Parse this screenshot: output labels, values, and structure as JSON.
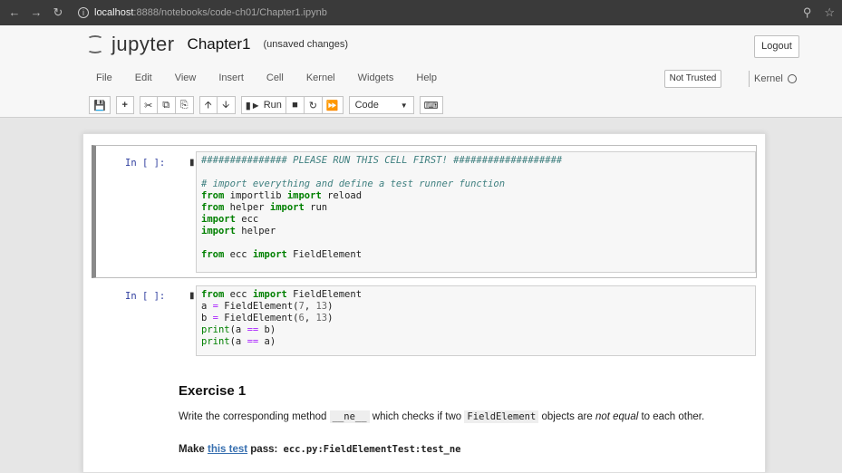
{
  "browser": {
    "url_host": "localhost",
    "url_path": ":8888/notebooks/code-ch01/Chapter1.ipynb"
  },
  "header": {
    "logo_text": "jupyter",
    "notebook_title": "Chapter1",
    "save_status": "(unsaved changes)",
    "logout_label": "Logout"
  },
  "menu": {
    "items": [
      "File",
      "Edit",
      "View",
      "Insert",
      "Cell",
      "Kernel",
      "Widgets",
      "Help"
    ],
    "trusted_label": "Not Trusted",
    "kernel_label": "Kernel"
  },
  "toolbar": {
    "run_label": "Run",
    "cell_type": "Code"
  },
  "cells": [
    {
      "prompt": "In [ ]:",
      "lines": [
        "############### PLEASE RUN THIS CELL FIRST! ###################",
        "",
        "# import everything and define a test runner function",
        "from importlib import reload",
        "from helper import run",
        "import ecc",
        "import helper",
        "",
        "from ecc import FieldElement"
      ]
    },
    {
      "prompt": "In [ ]:",
      "lines": [
        "from ecc import FieldElement",
        "a = FieldElement(7, 13)",
        "b = FieldElement(6, 13)",
        "print(a == b)",
        "print(a == a)"
      ]
    }
  ],
  "exercise": {
    "title": "Exercise 1",
    "desc_1": "Write the corresponding method",
    "desc_code1": "__ne__",
    "desc_2": "which checks if two",
    "desc_code2": "FieldElement",
    "desc_3": "objects are",
    "desc_em": "not equal",
    "desc_4": "to each other.",
    "make_1": "Make",
    "make_link": "this test",
    "make_2": "pass:",
    "make_code": "ecc.py:FieldElementTest:test_ne"
  }
}
